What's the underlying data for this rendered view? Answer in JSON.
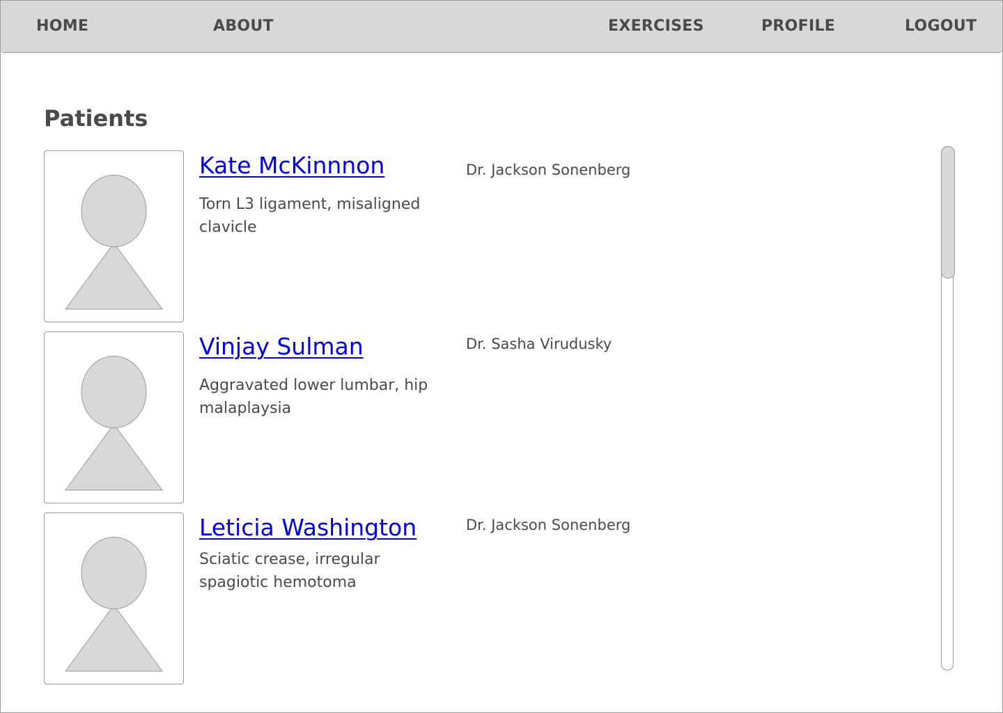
{
  "nav": {
    "home": "HOME",
    "about": "ABOUT",
    "exercises": "EXERCISES",
    "profile": "PROFILE",
    "logout": "LOGOUT"
  },
  "page": {
    "title": "Patients"
  },
  "patients": [
    {
      "name": "Kate McKinnnon",
      "condition": "Torn L3 ligament, misaligned clavicle",
      "doctor": "Dr. Jackson Sonenberg",
      "avatar_icon": "person-placeholder-icon"
    },
    {
      "name": "Vinjay Sulman",
      "condition": "Aggravated lower lumbar, hip malaplaysia",
      "doctor": "Dr. Sasha Virudusky",
      "avatar_icon": "person-placeholder-icon"
    },
    {
      "name": "Leticia Washington",
      "condition": "Sciatic crease, irregular spagiotic hemotoma",
      "doctor": "Dr. Jackson Sonenberg",
      "avatar_icon": "person-placeholder-icon"
    }
  ],
  "colors": {
    "nav_background": "#d8d8d8",
    "text": "#4a4a4a",
    "link": "#0000ee",
    "border": "#9a9a9a",
    "placeholder_fill": "#d8d8d8"
  }
}
